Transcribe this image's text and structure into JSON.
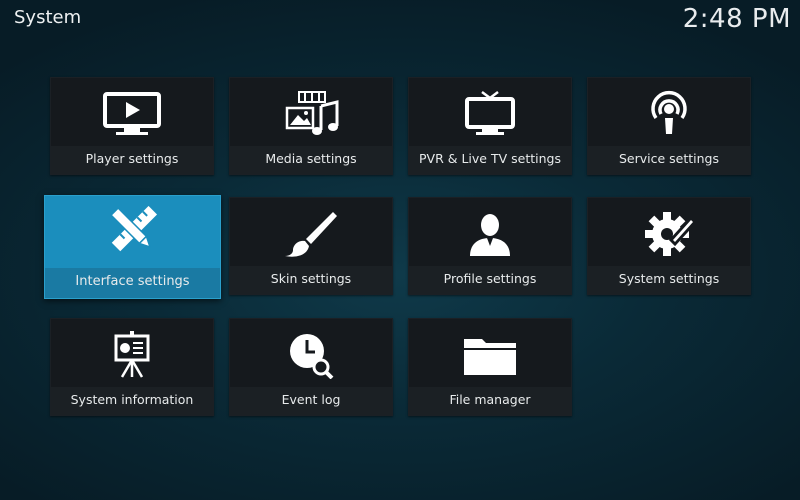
{
  "header": {
    "title": "System",
    "clock": "2:48 PM"
  },
  "tiles": [
    {
      "label": "Player settings",
      "icon": "player-settings-icon"
    },
    {
      "label": "Media settings",
      "icon": "media-settings-icon"
    },
    {
      "label": "PVR & Live TV settings",
      "icon": "pvr-tv-icon"
    },
    {
      "label": "Service settings",
      "icon": "service-settings-icon"
    },
    {
      "label": "Interface settings",
      "icon": "interface-settings-icon",
      "focused": true
    },
    {
      "label": "Skin settings",
      "icon": "paintbrush-icon"
    },
    {
      "label": "Profile settings",
      "icon": "profile-icon"
    },
    {
      "label": "System settings",
      "icon": "gear-wrench-icon"
    },
    {
      "label": "System information",
      "icon": "presentation-board-icon"
    },
    {
      "label": "Event log",
      "icon": "clock-search-icon"
    },
    {
      "label": "File manager",
      "icon": "folder-icon"
    }
  ],
  "colors": {
    "accent": "#1b8ebd",
    "tile_bg": "#15191d",
    "background": "#0a2a37"
  }
}
